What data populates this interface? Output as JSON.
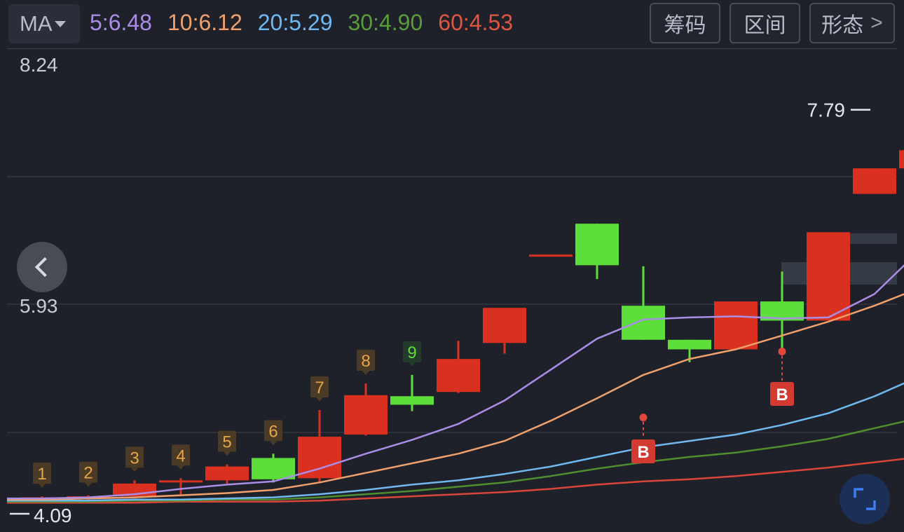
{
  "toolbar": {
    "indicator": "MA",
    "ma": [
      {
        "label": "5:6.48",
        "color": "#a98de6"
      },
      {
        "label": "10:6.12",
        "color": "#f0a06a"
      },
      {
        "label": "20:5.29",
        "color": "#6fb8f0"
      },
      {
        "label": "30:4.90",
        "color": "#5a9b3a"
      },
      {
        "label": "60:4.53",
        "color": "#e0553f"
      }
    ],
    "buttons": {
      "chouma": "筹码",
      "qujian": "区间",
      "xingtai": "形态"
    }
  },
  "chart_data": {
    "type": "candlestick",
    "y_labels": [
      "8.24",
      "5.93"
    ],
    "ylim": [
      3.95,
      8.36
    ],
    "high_marker": "7.79",
    "low_marker": "4.09",
    "colors": {
      "up": "#d9301f",
      "down": "#5ede3a",
      "ma5": "#a98de6",
      "ma10": "#f0a06a",
      "ma20": "#6fb8f0",
      "ma30": "#4f8e2e",
      "ma60": "#d9453a"
    },
    "candles": [
      {
        "o": 4.13,
        "h": 4.16,
        "l": 4.1,
        "c": 4.15,
        "tag": "1"
      },
      {
        "o": 4.15,
        "h": 4.17,
        "l": 4.12,
        "c": 4.16,
        "tag": "2"
      },
      {
        "o": 4.16,
        "h": 4.31,
        "l": 4.15,
        "c": 4.28,
        "tag": "3"
      },
      {
        "o": 4.29,
        "h": 4.33,
        "l": 4.16,
        "c": 4.31,
        "tag": "4"
      },
      {
        "o": 4.31,
        "h": 4.46,
        "l": 4.28,
        "c": 4.44,
        "tag": "5"
      },
      {
        "o": 4.52,
        "h": 4.56,
        "l": 4.29,
        "c": 4.32,
        "tag": "6"
      },
      {
        "o": 4.33,
        "h": 4.97,
        "l": 4.29,
        "c": 4.72,
        "tag": "7"
      },
      {
        "o": 4.74,
        "h": 5.22,
        "l": 4.73,
        "c": 5.11,
        "tag": "8"
      },
      {
        "o": 5.1,
        "h": 5.3,
        "l": 4.96,
        "c": 5.02,
        "tag": "9"
      },
      {
        "o": 5.14,
        "h": 5.62,
        "l": 5.13,
        "c": 5.45
      },
      {
        "o": 5.6,
        "h": 5.6,
        "l": 5.5,
        "c": 5.93
      },
      {
        "o": 6.43,
        "h": 6.43,
        "l": 6.43,
        "c": 6.43
      },
      {
        "o": 6.72,
        "h": 6.72,
        "l": 6.2,
        "c": 6.33
      },
      {
        "o": 5.95,
        "h": 6.32,
        "l": 5.63,
        "c": 5.63
      },
      {
        "o": 5.63,
        "h": 5.44,
        "l": 5.42,
        "c": 5.54
      },
      {
        "o": 5.54,
        "h": 5.74,
        "l": 5.71,
        "c": 5.99
      },
      {
        "o": 5.99,
        "h": 6.27,
        "l": 5.52,
        "c": 5.81,
        "b": true
      },
      {
        "o": 5.81,
        "h": 6.64,
        "l": 6.32,
        "c": 6.64
      },
      {
        "o": 7.0,
        "h": 7.24,
        "l": 7.21,
        "c": 7.24
      },
      {
        "o": 7.24,
        "h": 7.79,
        "l": 6.8,
        "c": 7.41
      }
    ],
    "ma5": [
      4.14,
      4.15,
      4.18,
      4.23,
      4.27,
      4.3,
      4.42,
      4.56,
      4.69,
      4.84,
      5.06,
      5.35,
      5.64,
      5.82,
      5.84,
      5.85,
      5.83,
      5.84,
      6.06,
      6.48
    ],
    "ma10": [
      4.13,
      4.14,
      4.15,
      4.17,
      4.19,
      4.22,
      4.29,
      4.38,
      4.47,
      4.56,
      4.68,
      4.87,
      5.08,
      5.3,
      5.45,
      5.54,
      5.67,
      5.8,
      5.95,
      6.12
    ],
    "ma20": [
      4.12,
      4.12,
      4.13,
      4.13,
      4.14,
      4.15,
      4.18,
      4.22,
      4.27,
      4.31,
      4.37,
      4.44,
      4.53,
      4.62,
      4.68,
      4.74,
      4.83,
      4.94,
      5.1,
      5.29
    ],
    "ma30": [
      4.11,
      4.11,
      4.12,
      4.12,
      4.13,
      4.13,
      4.15,
      4.18,
      4.21,
      4.25,
      4.29,
      4.35,
      4.42,
      4.48,
      4.53,
      4.57,
      4.63,
      4.7,
      4.8,
      4.9
    ],
    "ma60": [
      4.1,
      4.1,
      4.1,
      4.11,
      4.11,
      4.11,
      4.12,
      4.14,
      4.16,
      4.18,
      4.2,
      4.23,
      4.27,
      4.3,
      4.32,
      4.35,
      4.39,
      4.43,
      4.48,
      4.53
    ]
  }
}
